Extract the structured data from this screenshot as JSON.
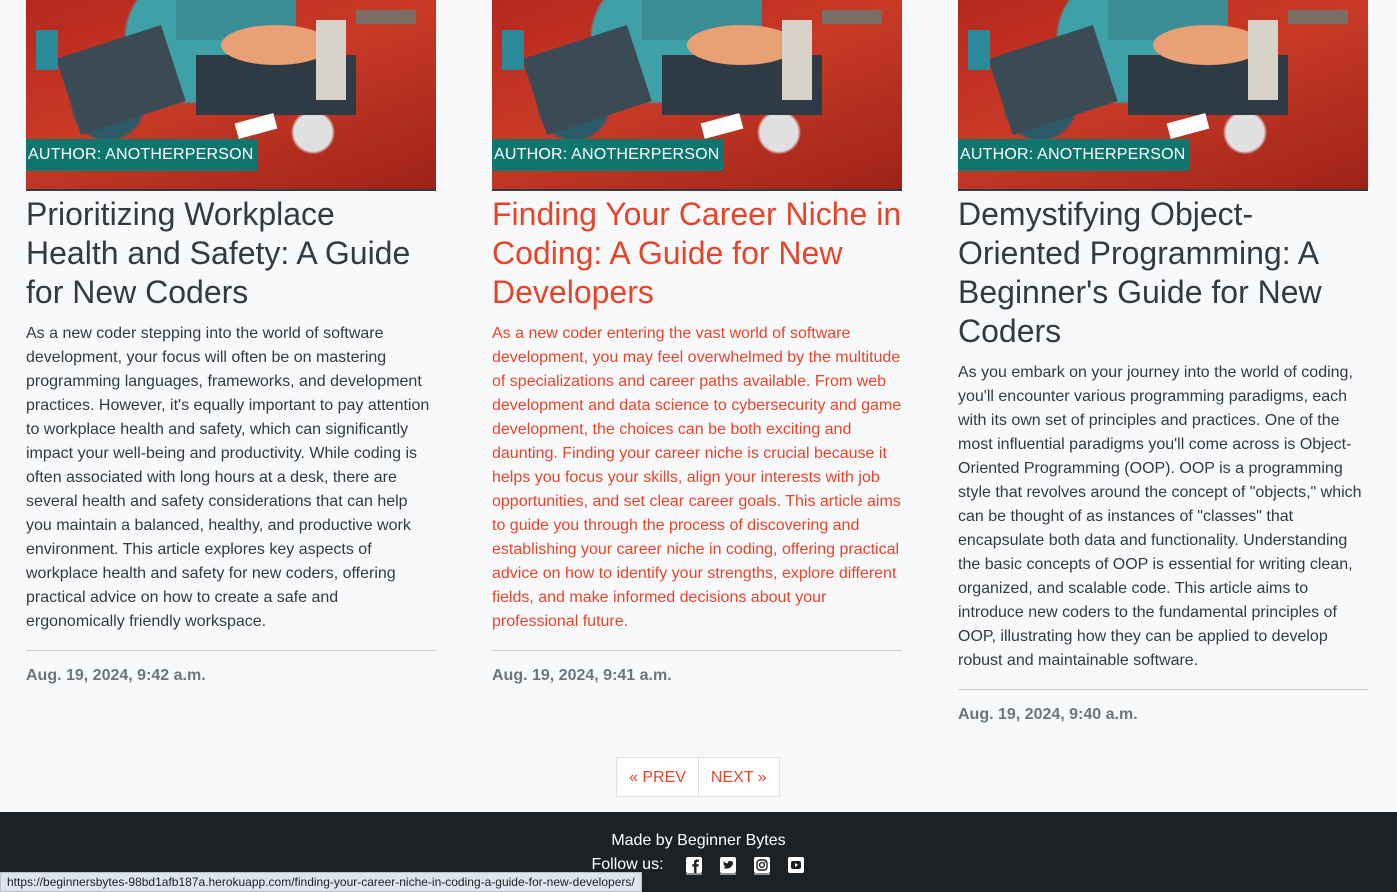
{
  "cards": [
    {
      "author_label": "AUTHOR: ANOTHERPERSON",
      "title": "Prioritizing Workplace Health and Safety: A Guide for New Coders",
      "excerpt": "As a new coder stepping into the world of software development, your focus will often be on mastering programming languages, frameworks, and development practices. However, it's equally important to pay attention to workplace health and safety, which can significantly impact your well-being and productivity. While coding is often associated with long hours at a desk, there are several health and safety considerations that can help you maintain a balanced, healthy, and productive work environment. This article explores key aspects of workplace health and safety for new coders, offering practical advice on how to create a safe and ergonomically friendly workspace.",
      "date": "Aug. 19, 2024, 9:42 a.m."
    },
    {
      "author_label": "AUTHOR: ANOTHERPERSON",
      "title": "Finding Your Career Niche in Coding: A Guide for New Developers",
      "excerpt": "As a new coder entering the vast world of software development, you may feel overwhelmed by the multitude of specializations and career paths available. From web development and data science to cybersecurity and game development, the choices can be both exciting and daunting. Finding your career niche is crucial because it helps you focus your skills, align your interests with job opportunities, and set clear career goals. This article aims to guide you through the process of discovering and establishing your career niche in coding, offering practical advice on how to identify your strengths, explore different fields, and make informed decisions about your professional future.",
      "date": "Aug. 19, 2024, 9:41 a.m."
    },
    {
      "author_label": "AUTHOR: ANOTHERPERSON",
      "title": "Demystifying Object-Oriented Programming: A Beginner's Guide for New Coders",
      "excerpt": "As you embark on your journey into the world of coding, you'll encounter various programming paradigms, each with its own set of principles and practices. One of the most influential paradigms you'll come across is Object-Oriented Programming (OOP). OOP is a programming style that revolves around the concept of \"objects,\" which can be thought of as instances of \"classes\" that encapsulate both data and functionality. Understanding the basic concepts of OOP is essential for writing clean, organized, and scalable code. This article aims to introduce new coders to the fundamental principles of OOP, illustrating how they can be applied to develop robust and maintainable software.",
      "date": "Aug. 19, 2024, 9:40 a.m."
    }
  ],
  "pagination": {
    "prev_label": "« PREV",
    "next_label": "NEXT »"
  },
  "footer": {
    "made_by": "Made by Beginner Bytes",
    "follow_label": "Follow us:",
    "social_icons": [
      "facebook-icon",
      "twitter-icon",
      "instagram-icon",
      "youtube-icon"
    ]
  },
  "status_bar": {
    "url": "https://beginnersbytes-98bd1afb187a.herokuapp.com/finding-your-career-niche-in-coding-a-guide-for-new-developers/"
  },
  "colors": {
    "accent": "#e8442a",
    "badge": "#0f766e",
    "footer_bg": "#1e2124"
  }
}
